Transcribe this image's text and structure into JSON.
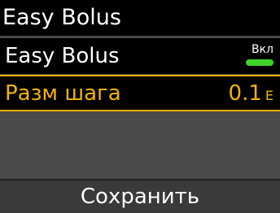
{
  "header": {
    "title": "Easy Bolus"
  },
  "rows": [
    {
      "label": "Easy Bolus",
      "toggle": {
        "state_text": "Вкл",
        "state": "on",
        "color": "#3fd42a"
      }
    },
    {
      "label": "Разм шага",
      "value": "0.1",
      "unit": "Е",
      "selected": true,
      "highlight_color": "#f2b400"
    }
  ],
  "footer": {
    "save_label": "Сохранить"
  }
}
